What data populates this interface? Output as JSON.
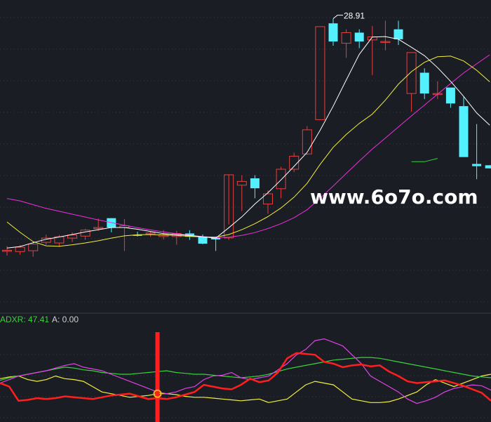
{
  "watermark": "www.6o7o.com",
  "colors": {
    "background": "#1b1d24",
    "grid": "#3a3d48",
    "up_candle": "#e4403f",
    "down_candle": "#53f0ff",
    "ma_white": "#ffffff",
    "ma_yellow": "#f2ef3e",
    "ma_magenta": "#ee2ee0",
    "ma_green": "#35d43a",
    "ind_red": "#ff1f1f",
    "ind_yellow": "#f2ef3e",
    "ind_green": "#39d43a",
    "ind_magenta": "#e042e6",
    "ind_orange": "#ffb020",
    "adxr_label": "#39d43a",
    "a_label": "#cfcfcf"
  },
  "chart_data": [
    {
      "type": "candlestick",
      "max_annotation": "28.91",
      "ylim": [
        15.8,
        29.5
      ],
      "candles": [
        {
          "o": 18.42,
          "h": 18.64,
          "l": 18.21,
          "c": 18.45
        },
        {
          "o": 18.39,
          "h": 18.68,
          "l": 18.25,
          "c": 18.59
        },
        {
          "o": 18.43,
          "h": 18.83,
          "l": 18.16,
          "c": 18.73
        },
        {
          "o": 18.81,
          "h": 19.15,
          "l": 18.7,
          "c": 19.0
        },
        {
          "o": 18.78,
          "h": 19.14,
          "l": 18.6,
          "c": 19.06
        },
        {
          "o": 19.0,
          "h": 19.26,
          "l": 18.83,
          "c": 19.14
        },
        {
          "o": 19.09,
          "h": 19.42,
          "l": 18.92,
          "c": 19.36
        },
        {
          "o": 19.43,
          "h": 19.88,
          "l": 19.33,
          "c": 19.48
        },
        {
          "o": 19.9,
          "h": 19.91,
          "l": 19.26,
          "c": 19.48
        },
        {
          "o": 19.48,
          "h": 19.86,
          "l": 18.42,
          "c": 19.56
        },
        {
          "o": 19.15,
          "h": 19.29,
          "l": 19.07,
          "c": 19.11
        },
        {
          "o": 19.21,
          "h": 19.31,
          "l": 19.06,
          "c": 19.23
        },
        {
          "o": 19.07,
          "h": 19.36,
          "l": 18.94,
          "c": 19.16
        },
        {
          "o": 19.07,
          "h": 19.33,
          "l": 18.7,
          "c": 19.21
        },
        {
          "o": 19.21,
          "h": 19.36,
          "l": 18.92,
          "c": 19.06
        },
        {
          "o": 19.07,
          "h": 19.16,
          "l": 18.72,
          "c": 18.75
        },
        {
          "o": 19.01,
          "h": 19.06,
          "l": 18.42,
          "c": 18.94
        },
        {
          "o": 19.01,
          "h": 19.62,
          "l": 18.92,
          "c": 21.86
        },
        {
          "o": 21.39,
          "h": 21.84,
          "l": 20.22,
          "c": 21.56
        },
        {
          "o": 21.7,
          "h": 21.84,
          "l": 20.8,
          "c": 21.25
        },
        {
          "o": 20.54,
          "h": 21.15,
          "l": 20.1,
          "c": 21.0
        },
        {
          "o": 21.23,
          "h": 22.22,
          "l": 20.8,
          "c": 22.11
        },
        {
          "o": 22.11,
          "h": 22.86,
          "l": 21.98,
          "c": 22.7
        },
        {
          "o": 22.8,
          "h": 24.06,
          "l": 22.76,
          "c": 23.89
        },
        {
          "o": 24.35,
          "h": 28.55,
          "l": 24.35,
          "c": 28.55
        },
        {
          "o": 28.7,
          "h": 28.91,
          "l": 27.69,
          "c": 27.88
        },
        {
          "o": 27.8,
          "h": 28.43,
          "l": 27.14,
          "c": 28.28
        },
        {
          "o": 28.28,
          "h": 28.43,
          "l": 27.58,
          "c": 27.88
        },
        {
          "o": 27.95,
          "h": 28.58,
          "l": 26.36,
          "c": 28.09
        },
        {
          "o": 27.88,
          "h": 28.82,
          "l": 27.48,
          "c": 27.88
        },
        {
          "o": 28.43,
          "h": 28.82,
          "l": 27.72,
          "c": 27.98
        },
        {
          "o": 25.53,
          "h": 27.38,
          "l": 24.71,
          "c": 27.38
        },
        {
          "o": 26.47,
          "h": 26.67,
          "l": 25.28,
          "c": 25.53
        },
        {
          "o": 25.53,
          "h": 26.08,
          "l": 25.28,
          "c": 25.53
        },
        {
          "o": 25.8,
          "h": 25.8,
          "l": 24.89,
          "c": 25.08
        },
        {
          "o": 24.96,
          "h": 25.37,
          "l": 22.76,
          "c": 22.66
        },
        {
          "o": 22.35,
          "h": 24.15,
          "l": 21.66,
          "c": 22.25
        },
        {
          "o": 22.29,
          "h": 22.3,
          "l": 22.2,
          "c": 22.15
        }
      ],
      "ma_white": [
        18.55,
        18.62,
        18.79,
        18.95,
        19.05,
        19.16,
        19.28,
        19.38,
        19.48,
        19.48,
        19.4,
        19.3,
        19.2,
        19.16,
        19.12,
        19.06,
        19.0,
        19.47,
        19.96,
        20.54,
        21.05,
        21.63,
        22.24,
        22.87,
        23.87,
        24.96,
        26.14,
        27.3,
        28.08,
        28.1,
        27.98,
        27.62,
        27.24,
        26.7,
        26.08,
        25.4,
        24.65,
        24.1
      ],
      "ma_yellow": [
        19.73,
        19.26,
        18.84,
        18.65,
        18.63,
        18.7,
        18.78,
        18.88,
        19.0,
        19.1,
        19.15,
        19.16,
        19.14,
        19.12,
        19.08,
        19.05,
        19.04,
        19.16,
        19.38,
        19.65,
        19.97,
        20.36,
        20.85,
        21.47,
        22.33,
        23.1,
        23.68,
        24.18,
        24.6,
        25.23,
        25.95,
        26.52,
        26.94,
        27.19,
        27.22,
        27.0,
        26.58,
        26.06
      ],
      "ma_magenta": [
        20.79,
        20.68,
        20.51,
        20.34,
        20.21,
        20.08,
        19.95,
        19.82,
        19.7,
        19.58,
        19.47,
        19.37,
        19.28,
        19.2,
        19.13,
        19.07,
        19.02,
        19.04,
        19.12,
        19.25,
        19.43,
        19.65,
        19.92,
        20.28,
        20.8,
        21.35,
        21.92,
        22.48,
        23.02,
        23.52,
        24.02,
        24.52,
        25.01,
        25.5,
        25.98,
        26.46,
        26.87,
        27.28
      ],
      "ma_green_last": [
        22.45,
        22.45,
        22.6
      ],
      "indicator": {
        "adxr_label": "ADXR: 47.41",
        "a_label": "A: 0.00",
        "ylim": [
          0,
          100
        ],
        "red": [
          40,
          36,
          20,
          21,
          23,
          22,
          23,
          25,
          24,
          23,
          22,
          24,
          26,
          27,
          28,
          25,
          22,
          23,
          22,
          24,
          27,
          30,
          38,
          36,
          34,
          33,
          38,
          45,
          41,
          43,
          52,
          68,
          74,
          73,
          72,
          64,
          62,
          58,
          60,
          61,
          59,
          60,
          53,
          48,
          42,
          40,
          41,
          42,
          43,
          40,
          37,
          33,
          29,
          20
        ],
        "magenta": [
          40,
          44,
          48,
          50,
          52,
          54,
          57,
          60,
          62,
          58,
          56,
          54,
          50,
          46,
          42,
          38,
          34,
          30,
          28,
          30,
          34,
          36,
          44,
          48,
          49,
          52,
          46,
          44,
          46,
          48,
          55,
          62,
          72,
          78,
          88,
          90,
          86,
          82,
          72,
          62,
          48,
          42,
          36,
          30,
          22,
          17,
          20,
          24,
          30,
          34,
          36,
          38,
          37,
          32
        ],
        "green": [
          43,
          46,
          48,
          50,
          52,
          54,
          56,
          58,
          57,
          55,
          54,
          52,
          51,
          50,
          50,
          51,
          52,
          53,
          54,
          52,
          51,
          50,
          50,
          49,
          48,
          47,
          46,
          47,
          48,
          50,
          53,
          56,
          58,
          60,
          62,
          64,
          66,
          67,
          68,
          69,
          69,
          68,
          66,
          64,
          62,
          60,
          58,
          56,
          54,
          52,
          50,
          48,
          47,
          46
        ],
        "yellow": [
          45,
          47,
          48,
          44,
          42,
          44,
          48,
          45,
          44,
          42,
          36,
          30,
          28,
          26,
          24,
          25,
          26,
          28,
          28,
          27,
          25,
          24,
          24,
          23,
          22,
          21,
          20,
          21,
          22,
          18,
          20,
          22,
          30,
          38,
          42,
          40,
          38,
          30,
          22,
          20,
          18,
          18,
          19,
          22,
          26,
          30,
          38,
          44,
          40,
          36,
          40,
          44,
          48,
          50
        ],
        "spike_index": 17
      }
    }
  ]
}
